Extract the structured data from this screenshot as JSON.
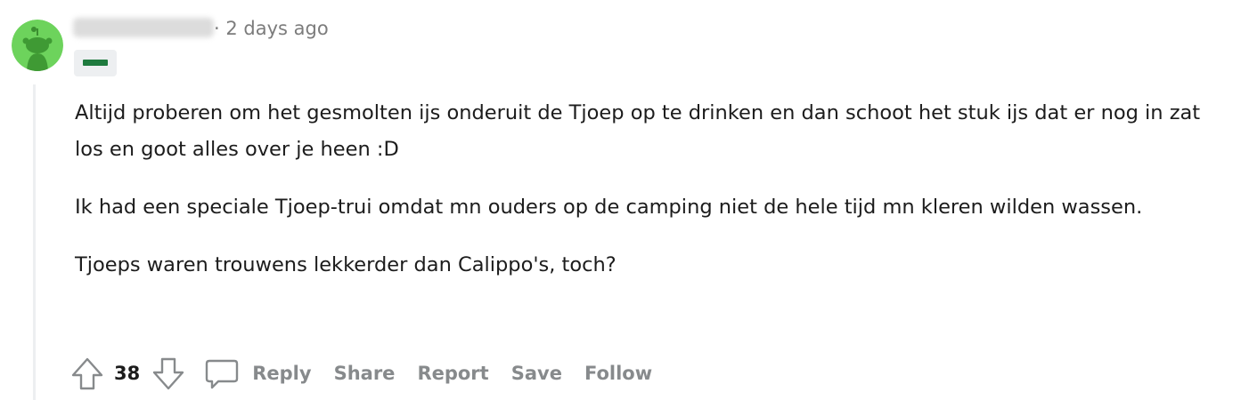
{
  "comment": {
    "timestamp": "· 2 days ago",
    "paragraphs": [
      "Altijd proberen om het gesmolten ijs onderuit de Tjoep op te drinken en dan schoot het stuk ijs dat er nog in zat los en goot alles over je heen :D",
      "Ik had een speciale Tjoep-trui omdat mn ouders op de camping niet de hele tijd mn kleren wilden wassen.",
      "Tjoeps waren trouwens lekkerder dan Calippo's, toch?"
    ],
    "score": "38",
    "actions": {
      "reply": "Reply",
      "share": "Share",
      "report": "Report",
      "save": "Save",
      "follow": "Follow"
    }
  },
  "colors": {
    "avatar": "#6dd35c",
    "flair": "#1e7a3e",
    "muted_text": "#878a8c",
    "thread_line": "#edeff1"
  },
  "icons": {
    "upvote": "arrow-up-icon",
    "downvote": "arrow-down-icon",
    "reply": "speech-bubble-icon"
  }
}
